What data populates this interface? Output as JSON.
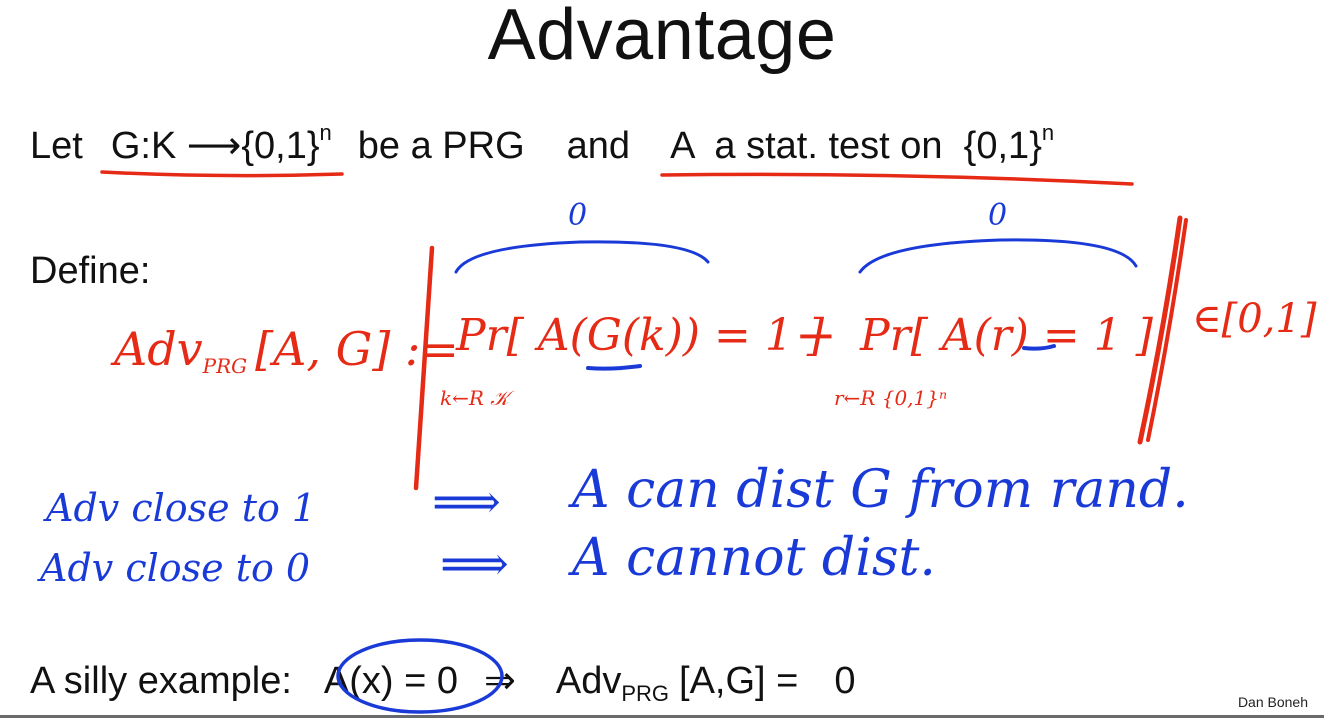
{
  "slide": {
    "title": "Advantage",
    "let_line": {
      "let": "Let",
      "g_def": "G:K ⟶{0,1}",
      "g_sup": "n",
      "be_prg": "be a PRG",
      "and": "and",
      "a_def": "A  a stat. test on  {0,1}",
      "a_sup": "n"
    },
    "define_label": "Define:",
    "example": {
      "label": "A silly example:",
      "expr": "A(x) = 0",
      "implies": "⇒",
      "adv": "Adv",
      "adv_sub": "PRG",
      "adv_args": "[A,G] =",
      "value": "0"
    },
    "author": "Dan Boneh"
  },
  "handwriting": {
    "adv_def_lhs": "Adv",
    "adv_def_sub": "PRG",
    "adv_def_args": "[A, G] :=",
    "pr1": "Pr[ A(G(k)) = 1 ]",
    "pr1_sub": "k←R 𝒦",
    "minus": "−",
    "pr2": "Pr[ A(r) = 1 ]",
    "pr2_sub": "r←R {0,1}ⁿ",
    "range": "∈[0,1]",
    "brace_label_1": "0",
    "brace_label_2": "0",
    "note1_lhs": "Adv close to 1",
    "note1_arrow": "⟹",
    "note1_rhs": "A can dist G from rand.",
    "note2_lhs": "Adv close to 0",
    "note2_arrow": "⟹",
    "note2_rhs": "A cannot dist."
  },
  "colors": {
    "red_ink": "#e52a16",
    "blue_ink": "#1a3ad8"
  }
}
